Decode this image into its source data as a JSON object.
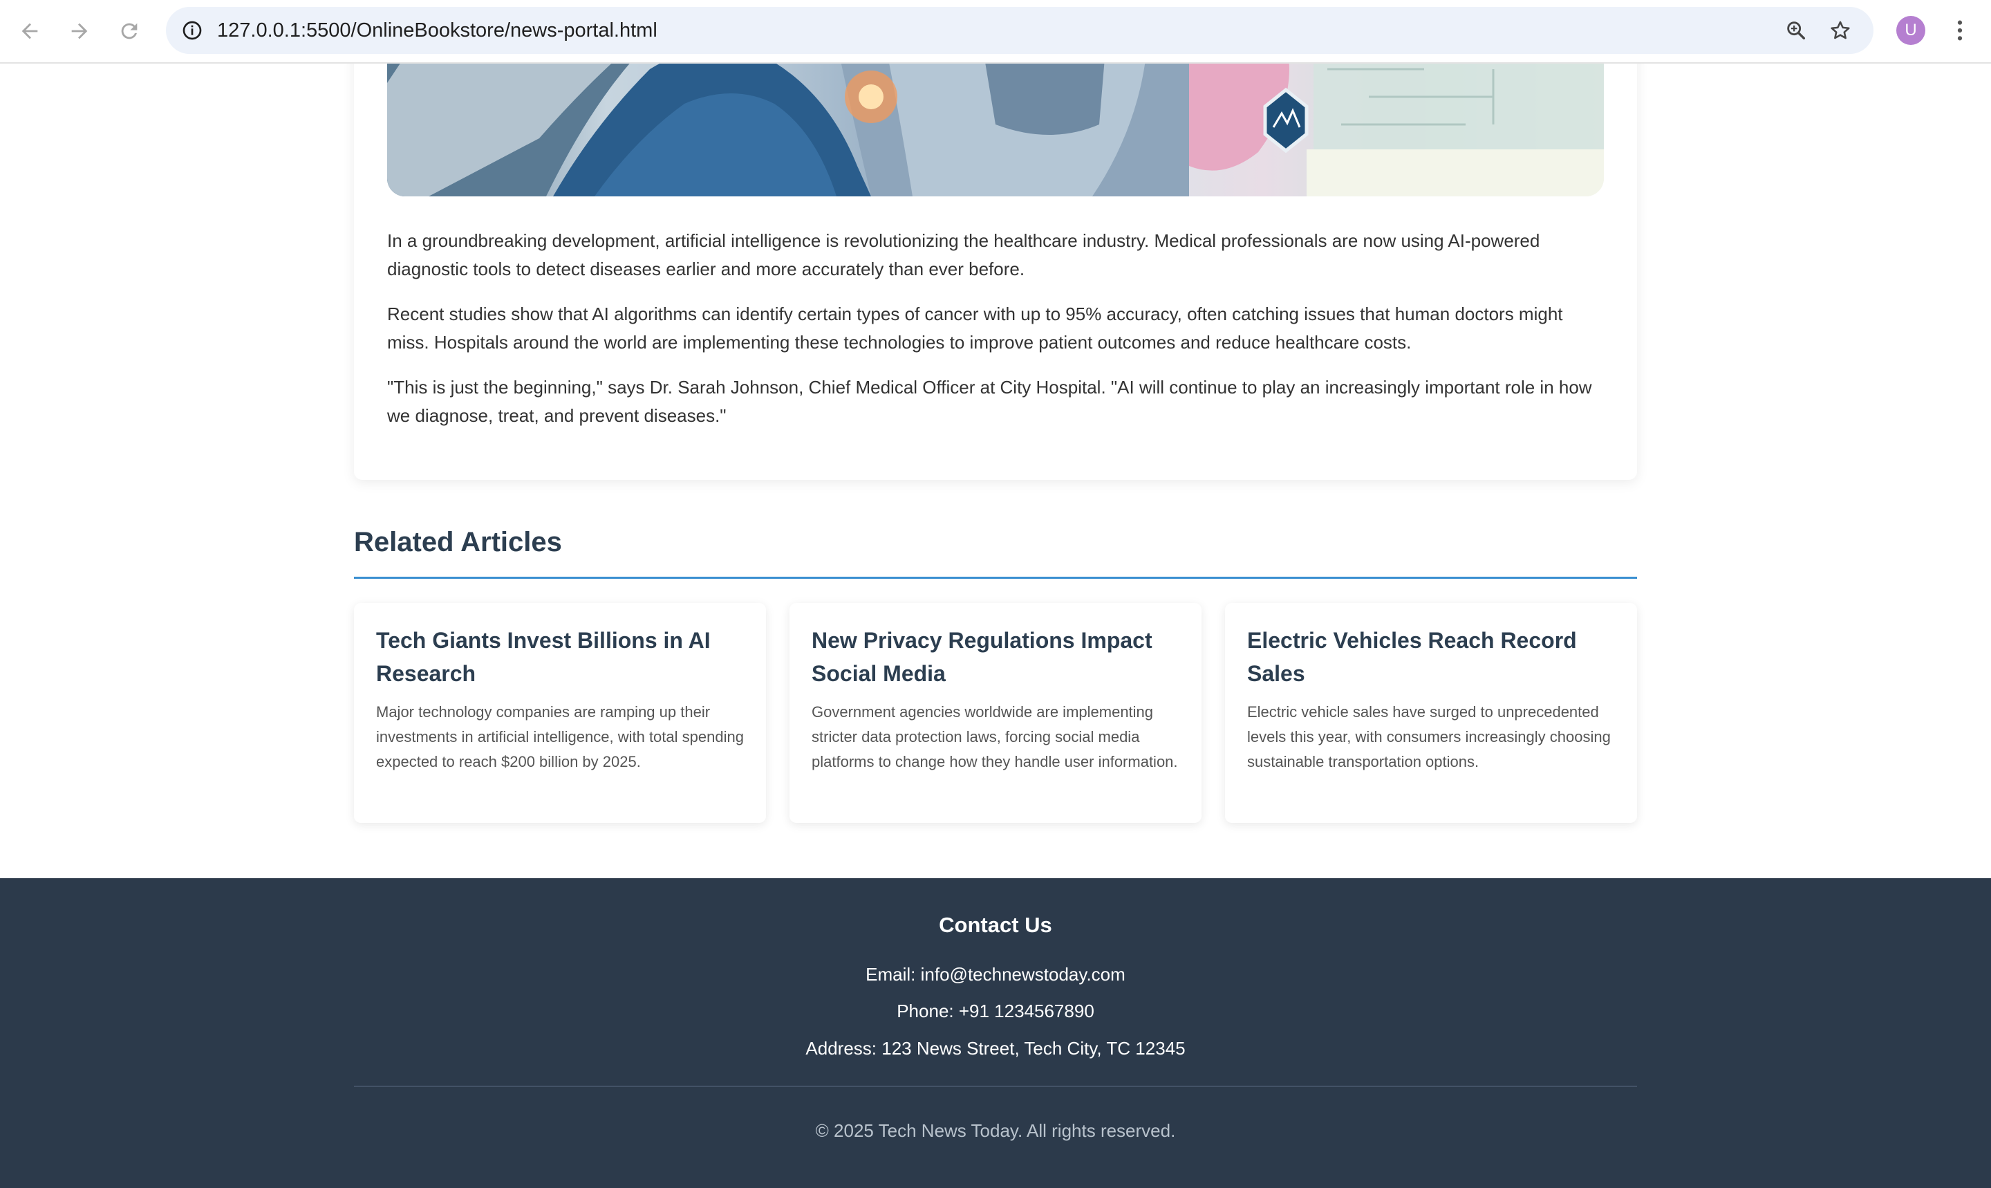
{
  "browser": {
    "url": "127.0.0.1:5500/OnlineBookstore/news-portal.html",
    "profile_initial": "U",
    "icons": [
      "back-icon",
      "forward-icon",
      "reload-icon",
      "site-info-icon",
      "zoom-icon",
      "bookmark-star-icon",
      "kebab-menu-icon"
    ]
  },
  "article": {
    "hero_image": "ai-healthcare-illustration",
    "paragraphs": [
      "In a groundbreaking development, artificial intelligence is revolutionizing the healthcare industry. Medical professionals are now using AI-powered diagnostic tools to detect diseases earlier and more accurately than ever before.",
      "Recent studies show that AI algorithms can identify certain types of cancer with up to 95% accuracy, often catching issues that human doctors might miss. Hospitals around the world are implementing these technologies to improve patient outcomes and reduce healthcare costs.",
      "\"This is just the beginning,\" says Dr. Sarah Johnson, Chief Medical Officer at City Hospital. \"AI will continue to play an increasingly important role in how we diagnose, treat, and prevent diseases.\""
    ]
  },
  "related": {
    "heading": "Related Articles",
    "accent_color": "#3a8fd1",
    "cards": [
      {
        "title": "Tech Giants Invest Billions in AI Research",
        "summary": "Major technology companies are ramping up their investments in artificial intelligence, with total spending expected to reach $200 billion by 2025."
      },
      {
        "title": "New Privacy Regulations Impact Social Media",
        "summary": "Government agencies worldwide are implementing stricter data protection laws, forcing social media platforms to change how they handle user information."
      },
      {
        "title": "Electric Vehicles Reach Record Sales",
        "summary": "Electric vehicle sales have surged to unprecedented levels this year, with consumers increasingly choosing sustainable transportation options."
      }
    ]
  },
  "footer": {
    "heading": "Contact Us",
    "email": "Email: info@technewstoday.com",
    "phone": "Phone: +91 1234567890",
    "address": "Address: 123 News Street, Tech City, TC 12345",
    "copyright": "© 2025 Tech News Today. All rights reserved.",
    "background_color": "#2c3a4b"
  }
}
